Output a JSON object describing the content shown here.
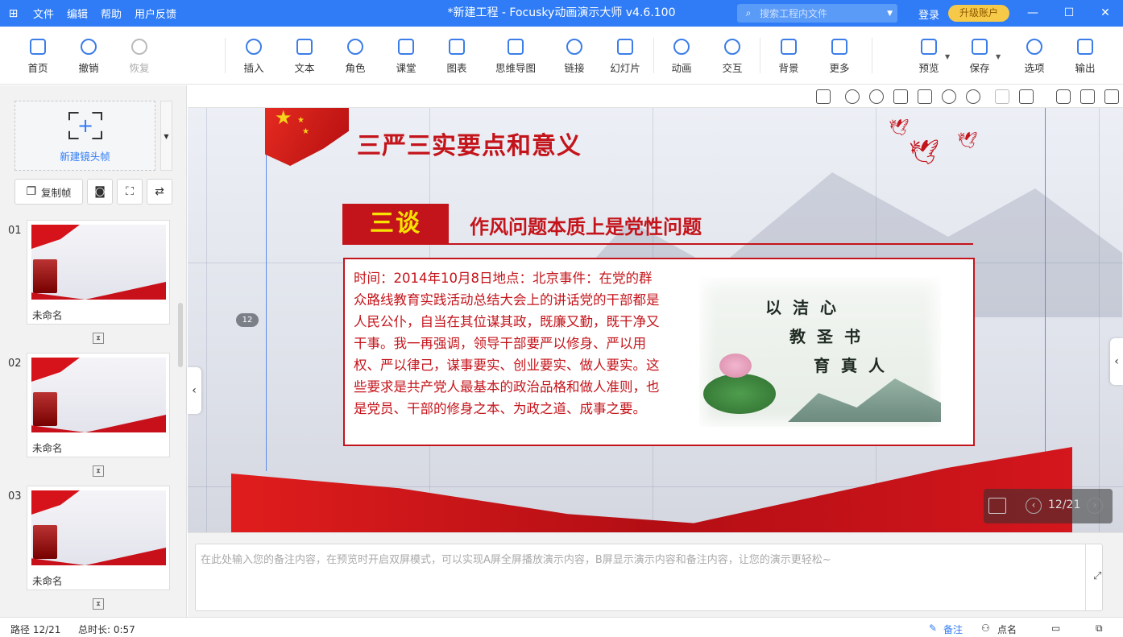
{
  "titlebar": {
    "menus": [
      "文件",
      "编辑",
      "帮助",
      "用户反馈"
    ],
    "title": "*新建工程 - Focusky动画演示大师  v4.6.100",
    "search_placeholder": "搜索工程内文件",
    "login": "登录",
    "upgrade": "升级账户"
  },
  "toolbar": {
    "home": "首页",
    "undo": "撤销",
    "redo": "恢复",
    "insert": "插入",
    "text": "文本",
    "role": "角色",
    "classroom": "课堂",
    "chart": "图表",
    "mindmap": "思维导图",
    "link": "链接",
    "slide": "幻灯片",
    "animation": "动画",
    "interaction": "交互",
    "background": "背景",
    "more": "更多",
    "preview": "预览",
    "save": "保存",
    "options": "选项",
    "export": "输出"
  },
  "left_panel": {
    "new_frame": "新建镜头帧",
    "copy_frame": "复制帧",
    "thumbnails": [
      {
        "num": "01",
        "name": "未命名"
      },
      {
        "num": "02",
        "name": "未命名"
      },
      {
        "num": "03",
        "name": "未命名"
      }
    ]
  },
  "slide": {
    "title": "三严三实要点和意义",
    "section_label": "三谈",
    "section_title": "作风问题本质上是党性问题",
    "body": "时间：2014年10月8日地点：北京事件：在党的群众路线教育实践活动总结大会上的讲话党的干部都是人民公仆，自当在其位谋其政，既廉又勤，既干净又干事。我一再强调，领导干部要严以修身、严以用权、严以律己，谋事要实、创业要实、做人要实。这些要求是共产党人最基本的政治品格和做人准则，也是党员、干部的修身之本、为政之道、成事之要。",
    "calligraphy": [
      "以洁心",
      "教圣书",
      "育真人"
    ],
    "path_badge": "12",
    "accent_color": "#c4141b"
  },
  "navigator": {
    "page": "12/21"
  },
  "notes": {
    "placeholder": "在此处输入您的备注内容，在预览时开启双屏模式，可以实现A屏全屏播放演示内容，B屏显示演示内容和备注内容，让您的演示更轻松~"
  },
  "statusbar": {
    "path": "路径 12/21",
    "duration": "总时长: 0:57",
    "notes": "备注",
    "rollcall": "点名"
  }
}
